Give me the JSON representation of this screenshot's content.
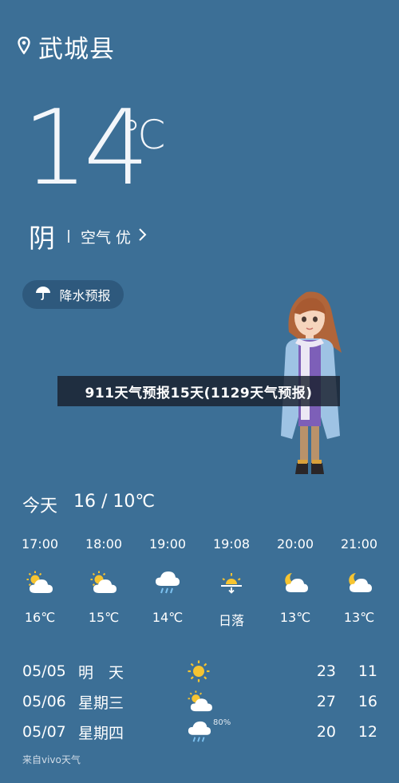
{
  "location": "武城县",
  "current": {
    "temperature": "14",
    "unit": "℃",
    "condition": "阴",
    "aqi_label": "空气 优",
    "chevron": "chevron-right-icon"
  },
  "rain_button": {
    "label": "降水预报",
    "icon": "umbrella-icon"
  },
  "banner": "911天气预报15天(1129天气预报)",
  "today": {
    "label": "今天",
    "range": "16 / 10℃"
  },
  "hourly": [
    {
      "time": "17:00",
      "icon": "partly-cloudy-icon",
      "value": "16℃"
    },
    {
      "time": "18:00",
      "icon": "partly-cloudy-icon",
      "value": "15℃"
    },
    {
      "time": "19:00",
      "icon": "rain-cloud-icon",
      "value": "14℃"
    },
    {
      "time": "19:08",
      "icon": "sunset-icon",
      "value": "日落"
    },
    {
      "time": "20:00",
      "icon": "cloudy-night-icon",
      "value": "13℃"
    },
    {
      "time": "21:00",
      "icon": "cloudy-night-icon",
      "value": "13℃"
    }
  ],
  "daily": [
    {
      "date": "05/05",
      "name": "明　天",
      "icon": "sunny-icon",
      "precip": "",
      "high": "23",
      "low": "11"
    },
    {
      "date": "05/06",
      "name": "星期三",
      "icon": "partly-cloudy-icon",
      "precip": "",
      "high": "27",
      "low": "16"
    },
    {
      "date": "05/07",
      "name": "星期四",
      "icon": "rain-cloud-icon",
      "precip": "80%",
      "high": "20",
      "low": "12"
    }
  ],
  "footer": "来自vivo天气",
  "colors": {
    "background": "#3c6f96",
    "sun": "#f6c431"
  }
}
